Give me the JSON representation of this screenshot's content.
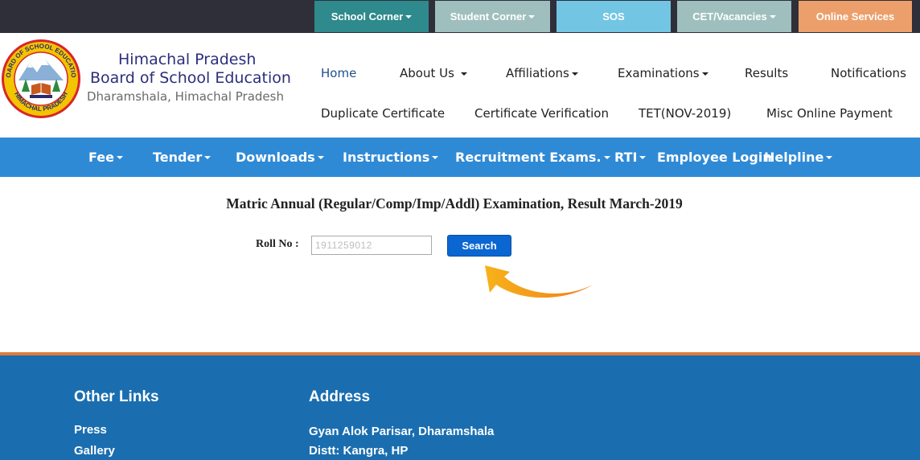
{
  "topbar": {
    "buttons": [
      {
        "label": "School Corner",
        "dropdown": true,
        "color": "#2e8a8c"
      },
      {
        "label": "Student Corner",
        "dropdown": true,
        "color": "#9ebfbd"
      },
      {
        "label": "SOS",
        "dropdown": false,
        "color": "#72c5e3"
      },
      {
        "label": "CET/Vacancies",
        "dropdown": true,
        "color": "#9ebfbd"
      },
      {
        "label": "Online Services",
        "dropdown": false,
        "color": "#ec9f6a"
      }
    ]
  },
  "header": {
    "org_line1": "Himachal Pradesh",
    "org_line2": "Board of School Education",
    "org_line3": "Dharamshala, Himachal Pradesh",
    "logo_text_top": "BOARD OF SCHOOL EDUCATION",
    "logo_text_bottom": "HIMACHAL PRADESH",
    "nav_row1": [
      "Home",
      "About Us",
      "Affiliations",
      "Examinations",
      "Results",
      "Notifications"
    ],
    "nav_row2": [
      "Duplicate Certificate",
      "Certificate Verification",
      "TET(NOV-2019)",
      "Misc Online Payment"
    ]
  },
  "menu": {
    "items": [
      "Fee",
      "Tender",
      "Downloads",
      "Instructions",
      "Recruitment Exams.",
      "RTI",
      "Employee Login",
      "Helpline"
    ]
  },
  "main": {
    "title": "Matric Annual (Regular/Comp/Imp/Addl) Examination, Result March-2019",
    "roll_label": "Roll No :",
    "roll_value": "1911259012",
    "search_label": "Search"
  },
  "footer": {
    "other_links_title": "Other Links",
    "other_links": [
      "Press",
      "Gallery"
    ],
    "address_title": "Address",
    "address_lines": [
      "Gyan Alok Parisar, Dharamshala",
      "Distt: Kangra, HP"
    ]
  },
  "colors": {
    "topbar_bg": "#2f2f3a",
    "menu_bg": "#2f8ad6",
    "footer_bg": "#1a6eb0",
    "footer_accent": "#e07a3a",
    "search_button": "#0a66d1",
    "arrow": "#f29a1f"
  },
  "icons": [
    "logo-emblem",
    "caret-down-icon",
    "curved-arrow-icon"
  ]
}
